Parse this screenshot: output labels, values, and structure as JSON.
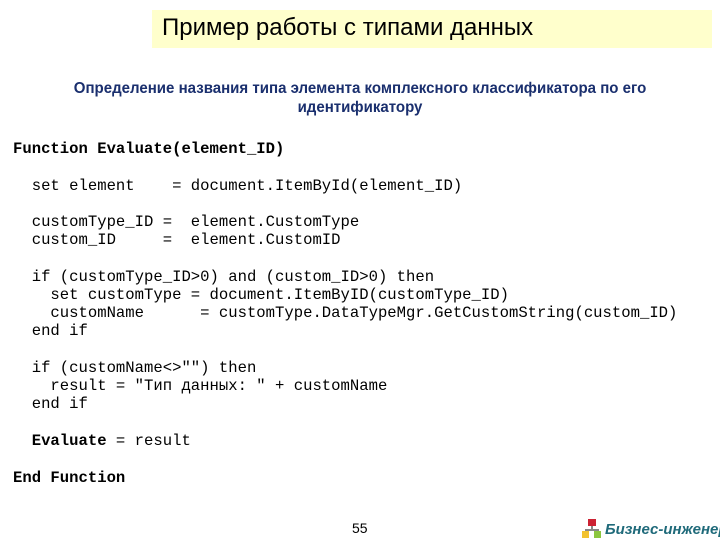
{
  "slide": {
    "title": "Пример работы с типами данных",
    "subtitle_line1": "Определение названия типа элемента комплексного классификатора по его",
    "subtitle_line2": "идентификатору",
    "page_number": "55"
  },
  "code": {
    "lines": [
      {
        "text": "Function Evaluate(element_ID)",
        "bold": true
      },
      {
        "text": "  set element    = document.ItemById(element_ID)",
        "bold": false
      },
      {
        "text": "  customType_ID =  element.CustomType",
        "bold": false
      },
      {
        "text": "  custom_ID     =  element.CustomID",
        "bold": false
      },
      {
        "text": "  if (customType_ID>0) and (custom_ID>0) then",
        "bold": false
      },
      {
        "text": "    set customType = document.ItemByID(customType_ID)",
        "bold": false
      },
      {
        "text": "    customName      = customType.DataTypeMgr.GetCustomString(custom_ID)",
        "bold": false
      },
      {
        "text": "  end if",
        "bold": false
      },
      {
        "text": "  if (customName<>\"\") then",
        "bold": false
      },
      {
        "text": "    result = \"Тип данных: \" + customName",
        "bold": false
      },
      {
        "text": "  end if",
        "bold": false
      },
      {
        "text": "  Evaluate = result",
        "bold": false
      },
      {
        "text": "End Function",
        "bold": true
      }
    ]
  },
  "footer": {
    "logo_text": "Бизнес-инженер",
    "logo_icon": "org-chart-icon",
    "brand_color": "#1f6a7a"
  },
  "colors": {
    "title_background": "#ffffcc",
    "subtitle_color": "#1a2f6e"
  }
}
